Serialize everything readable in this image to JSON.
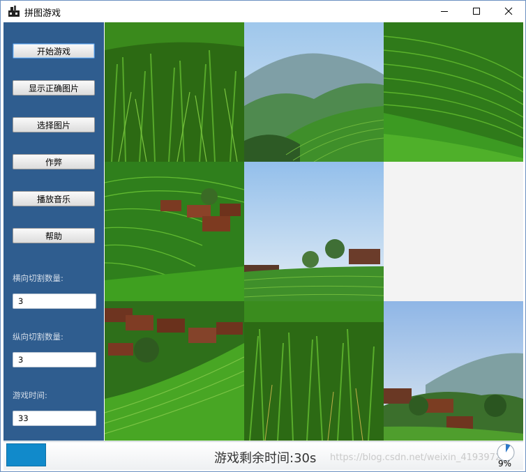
{
  "window": {
    "title": "拼图游戏"
  },
  "sidebar": {
    "buttons": [
      {
        "label": "开始游戏"
      },
      {
        "label": "显示正确图片"
      },
      {
        "label": "选择图片"
      },
      {
        "label": "作弊"
      },
      {
        "label": "播放音乐"
      },
      {
        "label": "帮助"
      }
    ],
    "fields": [
      {
        "label": "横向切割数量:",
        "value": "3"
      },
      {
        "label": "纵向切割数量:",
        "value": "3"
      },
      {
        "label": "游戏时间:",
        "value": "33"
      }
    ]
  },
  "board": {
    "rows": 3,
    "cols": 3,
    "tiles": [
      {
        "scene": "rice-stalks-closeup"
      },
      {
        "scene": "mountain-terraces-sky"
      },
      {
        "scene": "terrace-slope-right"
      },
      {
        "scene": "terraces-village-roofs"
      },
      {
        "scene": "sky-village-ridge"
      },
      {
        "scene": "empty"
      },
      {
        "scene": "village-roofs-hillside"
      },
      {
        "scene": "rice-stalks-dense"
      },
      {
        "scene": "misty-mountain-village"
      }
    ]
  },
  "status": {
    "remaining_text": "游戏剩余时间:30s",
    "progress_fraction": 0.09,
    "percent_label": "9%",
    "watermark": "https://blog.csdn.net/weixin_41939727"
  },
  "colors": {
    "sidebar_bg": "#2f5d8f",
    "progress_fill": "#118acb",
    "empty_tile": "#f3f3f3"
  }
}
